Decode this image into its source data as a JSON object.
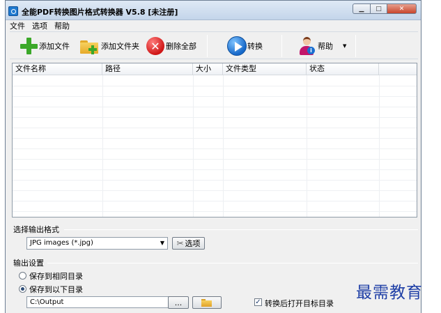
{
  "window": {
    "title": "全能PDF转换图片格式转换器 V5.8 [未注册]",
    "controls": {
      "minimize": "▁",
      "maximize": "□",
      "close": "✕"
    }
  },
  "menu": [
    "文件",
    "选项",
    "帮助"
  ],
  "toolbar": {
    "add_file": "添加文件",
    "add_folder": "添加文件夹",
    "delete_all": "删除全部",
    "convert": "转换",
    "help": "帮助",
    "help_dropdown": "▼"
  },
  "file_list": {
    "columns": [
      "文件名称",
      "路径",
      "大小",
      "文件类型",
      "状态"
    ],
    "rows": []
  },
  "output_format": {
    "section_label": "选择输出格式",
    "selected": "JPG images (*.jpg)",
    "options_button": "选项"
  },
  "output_settings": {
    "section_label": "输出设置",
    "same_dir": "保存到相同目录",
    "custom_dir": "保存到以下目录",
    "selected": "custom_dir",
    "path": "C:\\Output",
    "browse_button": "...",
    "open_after": "转换后打开目标目录",
    "open_after_checked": true
  },
  "watermark": "最需教育",
  "icons": {
    "add_file": "plus-icon",
    "add_folder": "folder-add-icon",
    "delete_all": "delete-icon",
    "convert": "play-icon",
    "help": "user-help-icon"
  },
  "colors": {
    "green": "#3ba829",
    "red": "#cf1616",
    "blue": "#1668c9",
    "watermark": "#1f3fa6"
  }
}
